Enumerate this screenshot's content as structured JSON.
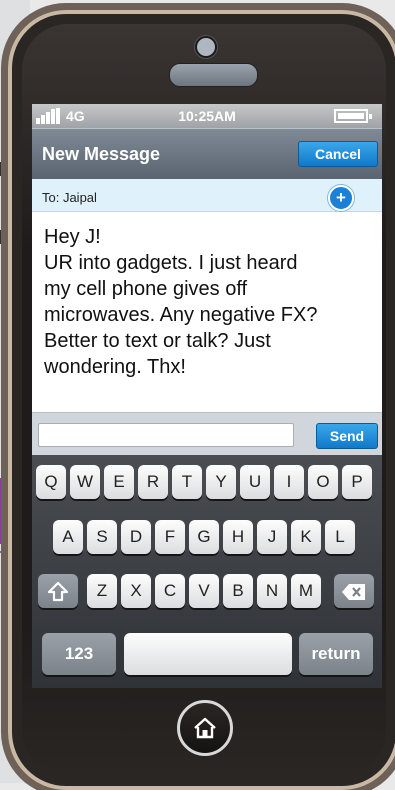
{
  "status_bar": {
    "network": "4G",
    "time": "10:25AM"
  },
  "nav": {
    "title": "New Message",
    "cancel_label": "Cancel"
  },
  "recipient": {
    "label": "To: Jaipal"
  },
  "message": {
    "lines": [
      "Hey J!",
      "UR into gadgets. I just heard",
      "my cell phone gives off",
      "microwaves. Any negative FX?",
      "Better to text or talk?  Just",
      "wondering. Thx!"
    ]
  },
  "compose": {
    "input_value": "",
    "send_label": "Send"
  },
  "keyboard": {
    "row1": [
      "Q",
      "W",
      "E",
      "R",
      "T",
      "Y",
      "U",
      "I",
      "O",
      "P"
    ],
    "row2": [
      "A",
      "S",
      "D",
      "F",
      "G",
      "H",
      "J",
      "K",
      "L"
    ],
    "row3": [
      "Z",
      "X",
      "C",
      "V",
      "B",
      "N",
      "M"
    ],
    "numbers_label": "123",
    "return_label": "return"
  },
  "colors": {
    "accent": "#1a7fd0",
    "navbar": "#6b7682"
  },
  "icons": {
    "shift": "shift-arrow-icon",
    "backspace": "backspace-icon",
    "home": "home-icon",
    "add": "add-contact-icon"
  }
}
